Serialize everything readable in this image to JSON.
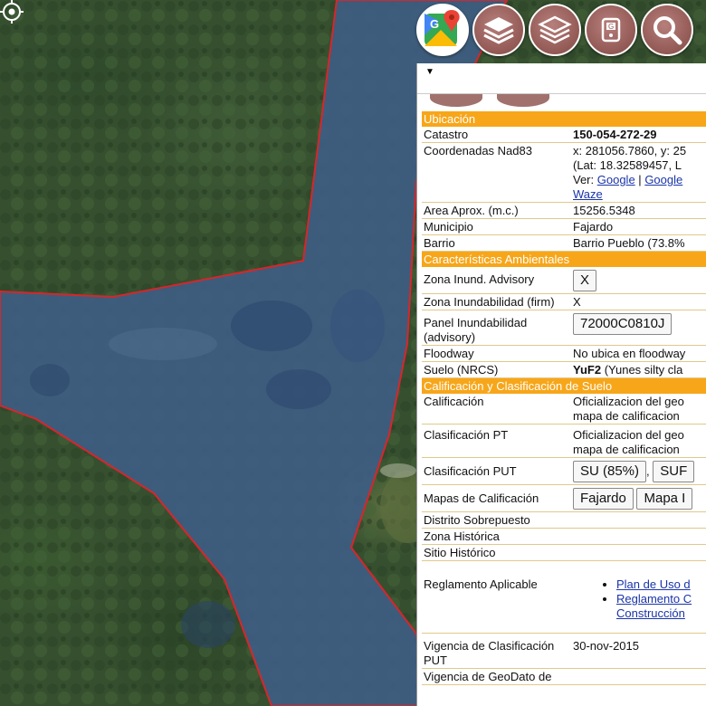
{
  "toolbar": {
    "buttons": [
      {
        "icon": "google-maps-icon"
      },
      {
        "icon": "layers-icon"
      },
      {
        "icon": "layers-outline-icon"
      },
      {
        "icon": "gps-device-icon"
      },
      {
        "icon": "search-icon"
      }
    ]
  },
  "panel": {
    "sections": {
      "ubicacion": "Ubicación",
      "ambientales": "Características Ambientales",
      "calificacion": "Calificación y Clasificación de Suelo"
    },
    "rows": {
      "catastro": {
        "label": "Catastro",
        "value": "150-054-272-29"
      },
      "coords": {
        "label": "Coordenadas Nad83",
        "line1": "x: 281056.7860, y: 25",
        "line2": "(Lat: 18.32589457, L",
        "ver": "Ver:",
        "google": "Google",
        "sep": "|",
        "google2": "Google",
        "waze": "Waze"
      },
      "area": {
        "label": "Area Aprox. (m.c.)",
        "value": "15256.5348"
      },
      "municipio": {
        "label": "Municipio",
        "value": "Fajardo"
      },
      "barrio": {
        "label": "Barrio",
        "value": "Barrio Pueblo (73.8%"
      },
      "zona_adv": {
        "label": "Zona Inund. Advisory",
        "value": "X"
      },
      "zona_firm": {
        "label": "Zona Inundabilidad (firm)",
        "value": "X"
      },
      "panel_inund": {
        "label_1": "Panel Inundabilidad",
        "label_2": "(advisory)",
        "value": "72000C0810J"
      },
      "floodway": {
        "label": "Floodway",
        "value": "No ubica en floodway"
      },
      "suelo": {
        "label": "Suelo (NRCS)",
        "code": "YuF2",
        "desc": "(Yunes silty cla"
      },
      "calif": {
        "label": "Calificación",
        "line1": "Oficializacion del geo",
        "line2": "mapa de calificacion"
      },
      "clasif_pt": {
        "label": "Clasificación PT",
        "line1": "Oficializacion del geo",
        "line2": "mapa de calificacion"
      },
      "clasif_put": {
        "label": "Clasificación PUT",
        "btn1": "SU (85%)",
        "sep": ",",
        "btn2": "SUF"
      },
      "mapas": {
        "label": "Mapas de Calificación",
        "btn1": "Fajardo",
        "btn2": "Mapa I"
      },
      "distrito": {
        "label": "Distrito Sobrepuesto",
        "value": ""
      },
      "zona_hist": {
        "label": "Zona Histórica",
        "value": ""
      },
      "sitio_hist": {
        "label": "Sitio Histórico",
        "value": ""
      },
      "reglamento": {
        "label": "Reglamento Aplicable",
        "item1": "Plan de Uso d",
        "item2_1": "Reglamento C",
        "item2_2": "Construcción"
      },
      "vigencia": {
        "label_1": "Vigencia de Clasificación",
        "label_2": "PUT",
        "value": "30-nov-2015"
      },
      "vigencia_geo": {
        "label": "Vigencia de GeoDato de"
      }
    }
  },
  "colors": {
    "section_header": "#f7a61a",
    "parcel_outline": "#d8252b",
    "parcel_fill": "#3a5a8a"
  }
}
